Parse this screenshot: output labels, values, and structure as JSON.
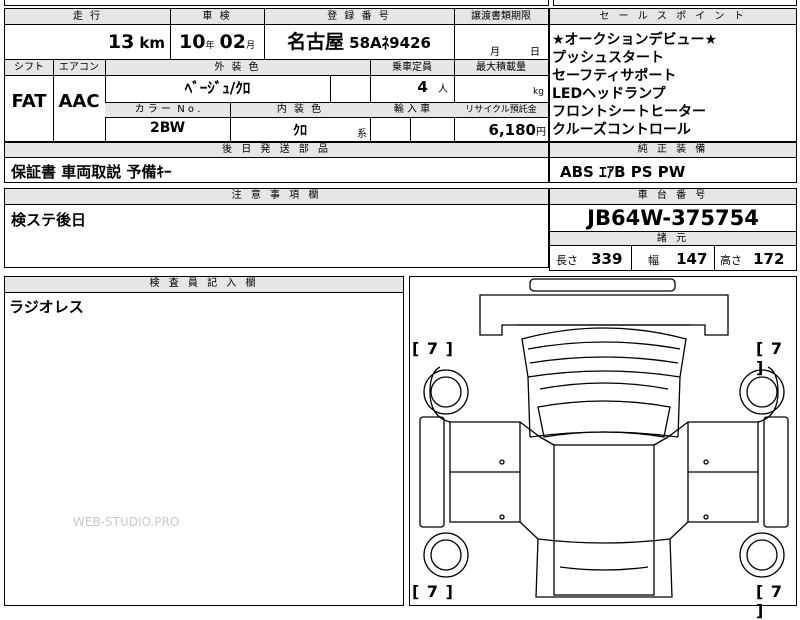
{
  "top_row": {
    "h_distance": "走 行",
    "h_shaken": "車 検",
    "h_reg": "登 録 番 号",
    "h_transfer": "譲渡書類期限",
    "distance_value": "13",
    "distance_unit": "km",
    "shaken_year": "10",
    "shaken_year_unit": "年",
    "shaken_month": "02",
    "shaken_month_unit": "月",
    "reg_city": "名古屋",
    "reg_class": "58A",
    "reg_kana": "ﾈ",
    "reg_number": "9426",
    "transfer_month": "月",
    "transfer_day": "日"
  },
  "mid_row": {
    "h_shift": "シフト",
    "h_aircon": "エアコン",
    "h_color_ext": "外 装 色",
    "h_capacity": "乗車定員",
    "h_max_load": "最大積載量",
    "shift": "FAT",
    "aircon": "AAC",
    "ext_color": "ﾍﾞｰｼﾞｭ/ｸﾛ",
    "capacity": "4",
    "capacity_unit": "人",
    "max_load_unit": "kg",
    "h_color_no": "カ ラ ー  N o .",
    "h_int_color": "内 装 色",
    "h_import": "輸 入 車",
    "h_recycle": "リサイクル預託金",
    "color_no": "2BW",
    "int_color": "ｸﾛ",
    "int_color_suffix": "系",
    "recycle_fee": "6,180",
    "recycle_unit": "円"
  },
  "accessories": {
    "header": "後 日 発 送 部 品",
    "value": "保証書 車両取説 予備ｷｰ"
  },
  "notes": {
    "header": "注 意 事 項 欄",
    "value": "検ステ後日"
  },
  "sales_points": {
    "header": "セ ー ル ス ポ イ ン ト",
    "lines": [
      "★オークションデビュー★",
      "プッシュスタート",
      "セーフティサポート",
      "LEDヘッドランプ",
      "フロントシートヒーター",
      "クルーズコントロール"
    ]
  },
  "genuine_equipment": {
    "header": "純 正 装 備",
    "value": "ABS ｴｱB PS PW"
  },
  "chassis": {
    "header": "車 台 番 号",
    "value": "JB64W-375754"
  },
  "dimensions": {
    "header": "諸 元",
    "length_label": "長さ",
    "length": "339",
    "width_label": "幅",
    "width": "147",
    "height_label": "高さ",
    "height": "172"
  },
  "inspector": {
    "header": "検 査 員 記 入 欄",
    "value": "ラジオレス"
  },
  "diagram": {
    "tl": "[ 7 ]",
    "tr": "[ 7 ]",
    "bl": "[ 7 ]",
    "br": "[ 7 ]"
  },
  "watermark": "WEB-STUDIO.PRO"
}
